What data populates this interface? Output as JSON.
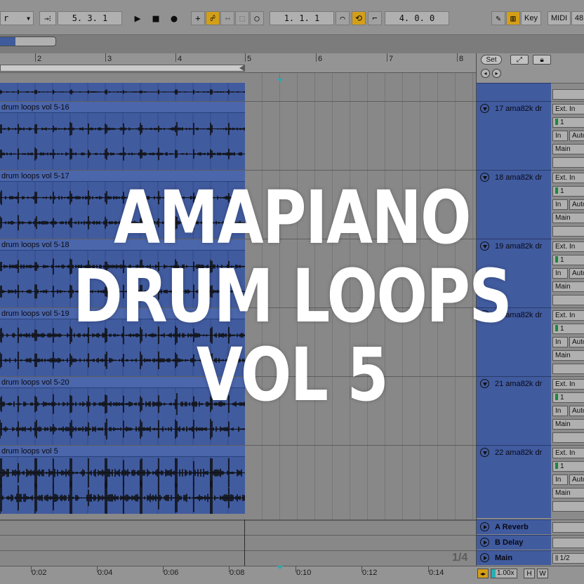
{
  "transport": {
    "follow_dropdown": "r",
    "arrangement_position": "5.  3.  1",
    "loop_start": "1.  1.  1",
    "loop_length": "4.  0.  0",
    "key_label": "Key",
    "midi_label": "MIDI",
    "cpu_label": "48"
  },
  "ruler": {
    "bars": [
      "2",
      "3",
      "4",
      "5",
      "6",
      "7",
      "8"
    ]
  },
  "side_top": {
    "set_label": "Set"
  },
  "clips": [
    {
      "name": ""
    },
    {
      "name": "drum loops vol 5-16"
    },
    {
      "name": "drum loops vol 5-17"
    },
    {
      "name": "drum loops vol 5-18"
    },
    {
      "name": "drum loops vol 5-19"
    },
    {
      "name": "drum loops vol 5-20"
    },
    {
      "name": "drum loops vol 5"
    }
  ],
  "tracks": [
    {
      "name": "17 ama82k dr",
      "input": "Ext. In",
      "channel": "1",
      "monitor_in": "In",
      "monitor_auto": "Auto",
      "output": "Main"
    },
    {
      "name": "18 ama82k dr",
      "input": "Ext. In",
      "channel": "1",
      "monitor_in": "In",
      "monitor_auto": "Auto",
      "output": "Main"
    },
    {
      "name": "19 ama82k dr",
      "input": "Ext. In",
      "channel": "1",
      "monitor_in": "In",
      "monitor_auto": "Auto",
      "output": "Main"
    },
    {
      "name": "20 ama82k dr",
      "input": "Ext. In",
      "channel": "1",
      "monitor_in": "In",
      "monitor_auto": "Auto",
      "output": "Main"
    },
    {
      "name": "21 ama82k dr",
      "input": "Ext. In",
      "channel": "1",
      "monitor_in": "In",
      "monitor_auto": "Auto",
      "output": "Main"
    },
    {
      "name": "22 ama82k dr",
      "input": "Ext. In",
      "channel": "1",
      "monitor_in": "In",
      "monitor_auto": "Auto",
      "output": "Main"
    }
  ],
  "returns": [
    {
      "name": "A Reverb"
    },
    {
      "name": "B Delay"
    },
    {
      "name": "Main"
    }
  ],
  "main_output": "1/2",
  "page_indicator": "1/4",
  "timeline": {
    "labels": [
      "0:02",
      "0:04",
      "0:06",
      "0:08",
      "0:10",
      "0:12",
      "0:14"
    ]
  },
  "footer": {
    "zoom": "1.00x",
    "h_label": "H",
    "w_label": "W"
  },
  "overlay": {
    "line1": "AMAPIANO",
    "line2": "DRUM LOOPS",
    "line3": "VOL 5"
  },
  "colors": {
    "clip": "#4a68b6",
    "accent": "#f2b51c",
    "marker": "#29c2c9"
  }
}
